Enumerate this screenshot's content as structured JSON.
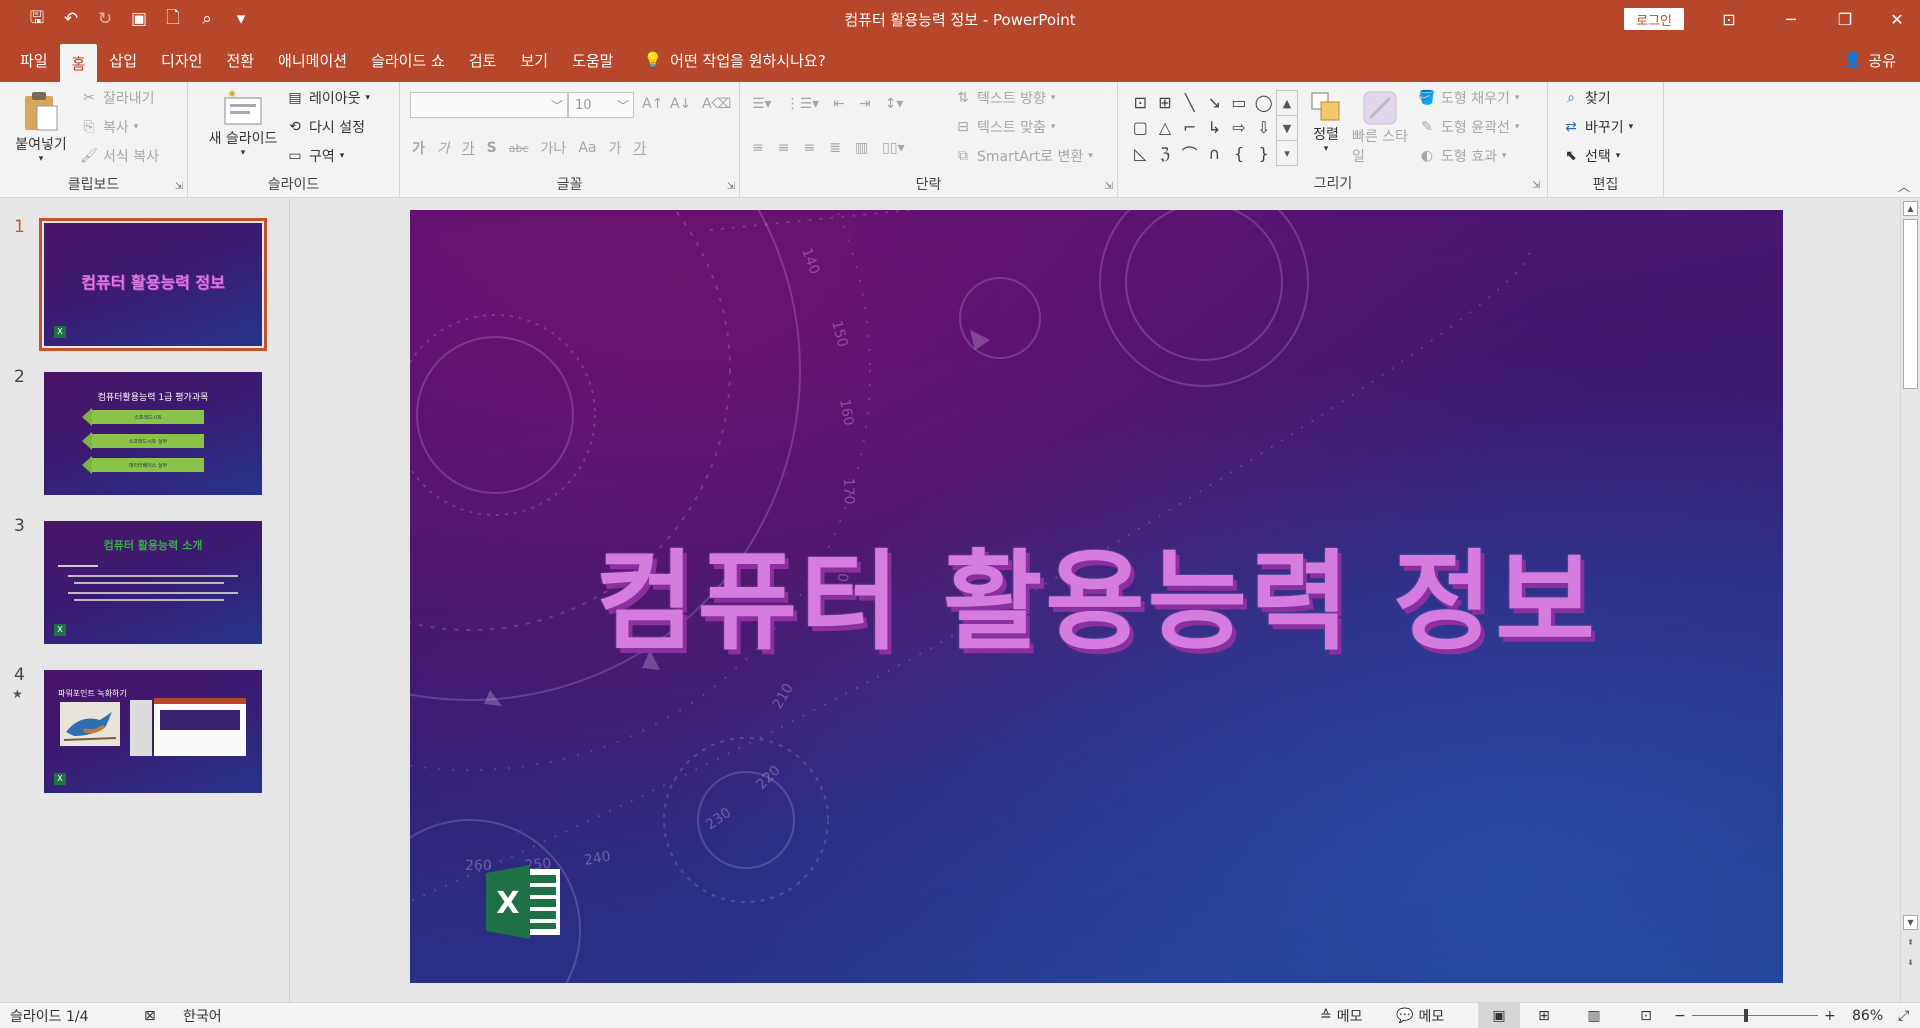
{
  "window": {
    "title": "컴퓨터 활용능력 정보  -  PowerPoint",
    "login_label": "로그인",
    "minimize": "─",
    "restore": "❐",
    "close": "✕",
    "ribbon_display": "⊡"
  },
  "qat": {
    "save_icon": "🖫",
    "undo_icon": "↶",
    "redo_icon": "↻",
    "present_icon": "▣",
    "new_icon": "🗋",
    "preview_icon": "⌕",
    "more_icon": "▾"
  },
  "tabs": [
    "파일",
    "홈",
    "삽입",
    "디자인",
    "전환",
    "애니메이션",
    "슬라이드 쇼",
    "검토",
    "보기",
    "도움말"
  ],
  "tell_me": "어떤 작업을 원하시나요?",
  "share": "공유",
  "ribbon": {
    "clipboard": {
      "label": "클립보드",
      "paste": "붙여넣기",
      "cut": "잘라내기",
      "copy": "복사",
      "format_painter": "서식 복사"
    },
    "slides": {
      "label": "슬라이드",
      "new_slide": "새 슬라이드",
      "layout": "레이아웃",
      "reset": "다시 설정",
      "section": "구역"
    },
    "font": {
      "label": "글꼴",
      "font_size": "10",
      "buttons": [
        "가",
        "가",
        "가",
        "S",
        "abc",
        "가나",
        "Aa",
        "가",
        "가"
      ]
    },
    "paragraph": {
      "label": "단락",
      "text_direction": "텍스트 방향",
      "align_text": "텍스트 맞춤",
      "smartart": "SmartArt로 변환"
    },
    "drawing": {
      "label": "그리기",
      "arrange": "정렬",
      "quick_styles": "빠른 스타일",
      "shape_fill": "도형 채우기",
      "shape_outline": "도형 윤곽선",
      "shape_effects": "도형 효과"
    },
    "editing": {
      "label": "편집",
      "find": "찾기",
      "replace": "바꾸기",
      "select": "선택"
    }
  },
  "thumbnails": [
    {
      "number": "1",
      "title": "컴퓨터 활용능력 정보"
    },
    {
      "number": "2",
      "title": "컴퓨터활용능력 1급 평가과목",
      "items": [
        "스프레드시트",
        "스프레드시트 실무",
        "데이터베이스 실무"
      ]
    },
    {
      "number": "3",
      "title": "컴퓨터 활용능력 소개"
    },
    {
      "number": "4",
      "title": "파워포인트 녹화하기"
    }
  ],
  "slide": {
    "title": "컴퓨터 활용능력 정보",
    "logo_letter": "X"
  },
  "status": {
    "slide_counter": "슬라이드 1/4",
    "language": "한국어",
    "notes": "메모",
    "comments": "메모",
    "zoom": "86%",
    "zoom_level": 0.43
  }
}
